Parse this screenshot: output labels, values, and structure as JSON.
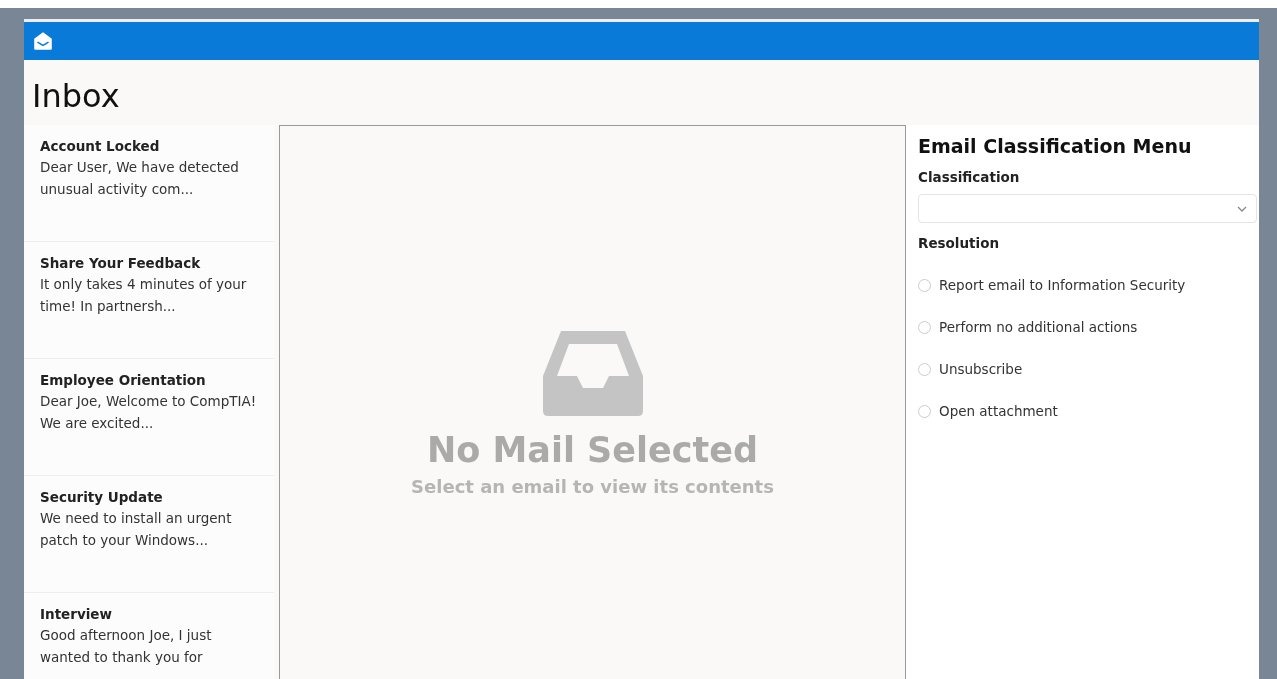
{
  "header": {
    "title": "Inbox"
  },
  "mails": [
    {
      "subject": "Account Locked",
      "preview": "Dear User, We have detected unusual activity com..."
    },
    {
      "subject": "Share Your Feedback",
      "preview": "It only takes 4 minutes of your time! In partnersh..."
    },
    {
      "subject": "Employee Orientation",
      "preview": "Dear Joe, Welcome to CompTIA! We are excited..."
    },
    {
      "subject": "Security Update",
      "preview": "We need to install an urgent patch to your Windows..."
    },
    {
      "subject": "Interview",
      "preview": "Good afternoon Joe, I just wanted to thank you for"
    }
  ],
  "viewer": {
    "title": "No Mail Selected",
    "subtitle": "Select an email to view its contents"
  },
  "classification_menu": {
    "title": "Email Classification Menu",
    "classification_label": "Classification",
    "resolution_label": "Resolution",
    "resolutions": [
      {
        "label": "Report email to Information Security",
        "selected": false
      },
      {
        "label": "Perform no additional actions",
        "selected": false
      },
      {
        "label": "Unsubscribe",
        "selected": false
      },
      {
        "label": "Open attachment",
        "selected": false
      }
    ]
  }
}
